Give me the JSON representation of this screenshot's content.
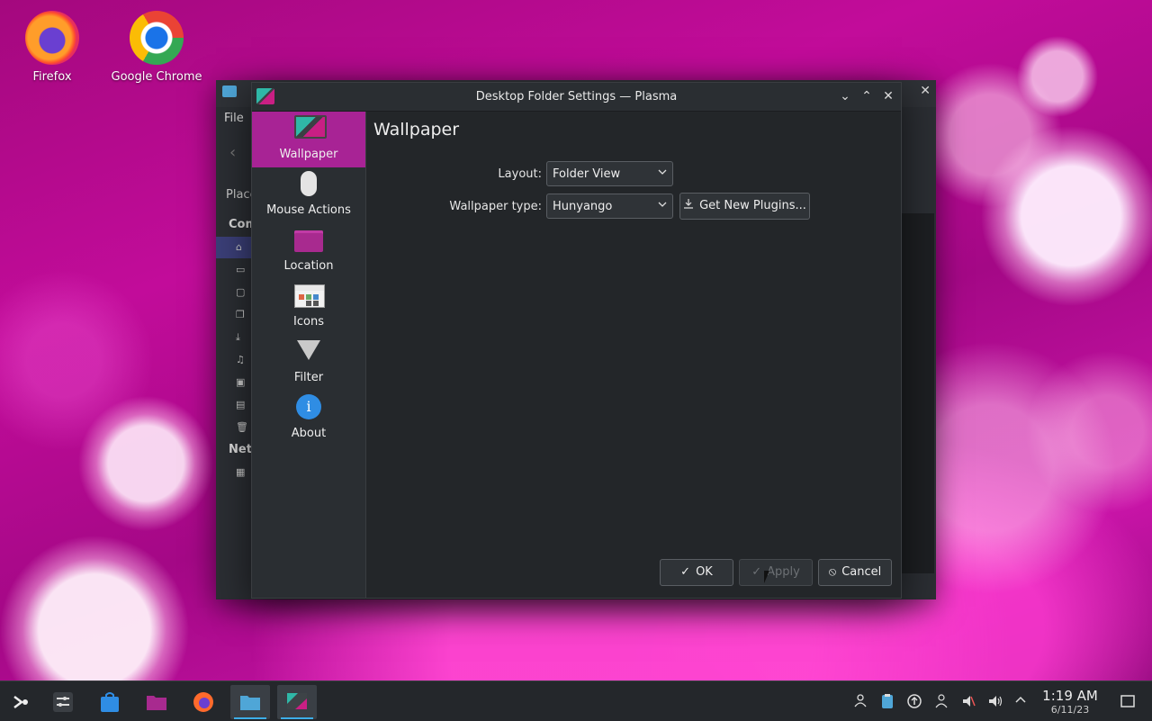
{
  "desktop": {
    "icons": [
      {
        "label": "Firefox",
        "icon": "firefox-icon"
      },
      {
        "label": "Google Chrome",
        "icon": "chrome-icon"
      }
    ]
  },
  "background_window": {
    "menu_first": "File",
    "places_label": "Place",
    "section1_label": "Com",
    "section2_label": "Net"
  },
  "dialog": {
    "title": "Desktop Folder Settings — Plasma",
    "sidebar": [
      {
        "label": "Wallpaper",
        "icon": "monitor-icon",
        "active": true
      },
      {
        "label": "Mouse Actions",
        "icon": "mouse-icon"
      },
      {
        "label": "Location",
        "icon": "folder-icon"
      },
      {
        "label": "Icons",
        "icon": "icons-grid-icon"
      },
      {
        "label": "Filter",
        "icon": "filter-icon"
      },
      {
        "label": "About",
        "icon": "info-icon"
      }
    ],
    "page_title": "Wallpaper",
    "layout_label": "Layout:",
    "layout_value": "Folder View",
    "wallpaper_type_label": "Wallpaper type:",
    "wallpaper_type_value": "Hunyango",
    "get_plugins_label": "Get New Plugins...",
    "ok_label": "OK",
    "apply_label": "Apply",
    "cancel_label": "Cancel",
    "info_glyph": "i"
  },
  "taskbar": {
    "time": "1:19 AM",
    "date": "6/11/23",
    "accent": "#3daee9"
  },
  "colors": {
    "sidebar_active": "#a82395",
    "dialog_bg": "#232629"
  }
}
